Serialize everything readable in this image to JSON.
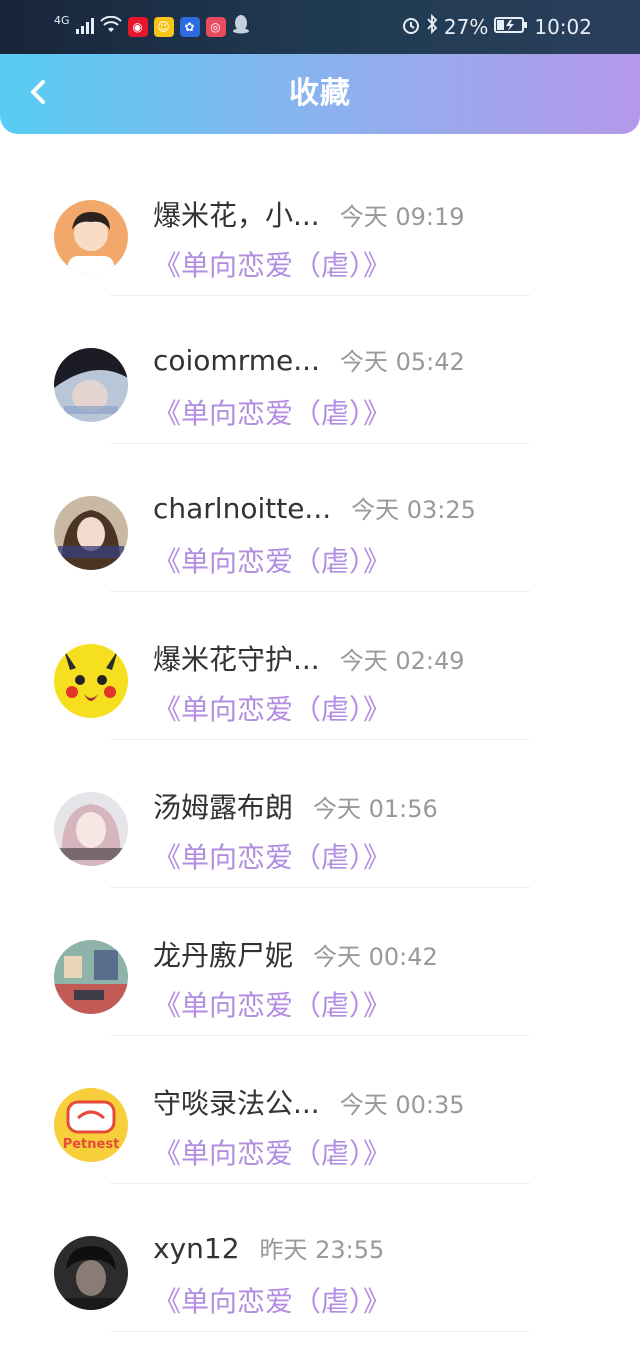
{
  "status_bar": {
    "network": "4G",
    "battery": "27%",
    "time": "10:02"
  },
  "header": {
    "title": "收藏"
  },
  "favorites": [
    {
      "name": "爆米花，小...",
      "time": "今天 09:19",
      "subtitle": "《单向恋爱（虐）》"
    },
    {
      "name": "coiomrme...",
      "time": "今天 05:42",
      "subtitle": "《单向恋爱（虐）》"
    },
    {
      "name": "charlnoitte...",
      "time": "今天 03:25",
      "subtitle": "《单向恋爱（虐）》"
    },
    {
      "name": "爆米花守护...",
      "time": "今天 02:49",
      "subtitle": "《单向恋爱（虐）》"
    },
    {
      "name": "汤姆露布朗",
      "time": "今天 01:56",
      "subtitle": "《单向恋爱（虐）》"
    },
    {
      "name": "龙丹廒尸妮",
      "time": "今天 00:42",
      "subtitle": "《单向恋爱（虐）》"
    },
    {
      "name": "守啖录法公...",
      "time": "今天 00:35",
      "subtitle": "《单向恋爱（虐）》"
    },
    {
      "name": "xyn12",
      "time": "昨天 23:55",
      "subtitle": "《单向恋爱（虐）》"
    }
  ],
  "avatar_texts": {
    "petnest": "Petnest"
  },
  "colors": {
    "header_start": "#57cdf2",
    "header_end": "#b598ea",
    "subtitle": "#b28de0",
    "name": "#333333",
    "time": "#999999"
  }
}
